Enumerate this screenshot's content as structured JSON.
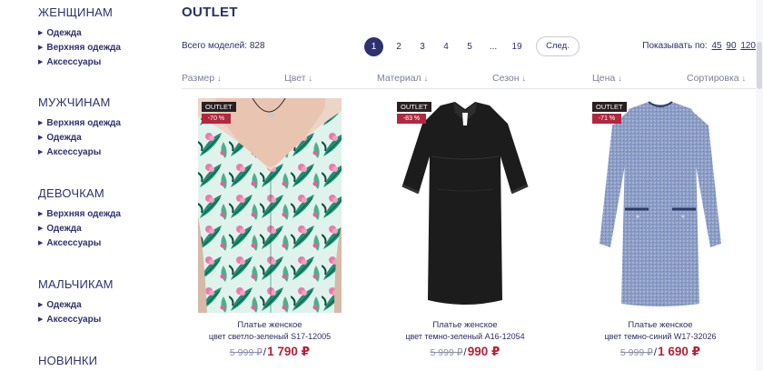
{
  "sidebar": {
    "women": {
      "title": "ЖЕНЩИНАМ",
      "items": [
        "Одежда",
        "Верхняя одежда",
        "Аксессуары"
      ]
    },
    "men": {
      "title": "МУЖЧИНАМ",
      "items": [
        "Верхняя одежда",
        "Одежда",
        "Аксессуары"
      ]
    },
    "girls": {
      "title": "ДЕВОЧКАМ",
      "items": [
        "Верхняя одежда",
        "Одежда",
        "Аксессуары"
      ]
    },
    "boys": {
      "title": "МАЛЬЧИКАМ",
      "items": [
        "Одежда",
        "Аксессуары"
      ]
    },
    "new": {
      "title": "НОВИНКИ"
    }
  },
  "header": {
    "title": "OUTLET",
    "total_models": "Всего моделей: 828"
  },
  "pagination": {
    "pages": [
      "1",
      "2",
      "3",
      "4",
      "5",
      "...",
      "19"
    ],
    "current": "1",
    "next_label": "След."
  },
  "per_page": {
    "label": "Показывать по:",
    "options": [
      "45",
      "90",
      "120"
    ]
  },
  "filters": [
    "Размер",
    "Цвет",
    "Материал",
    "Сезон",
    "Цена",
    "Сортировка"
  ],
  "filter_arrow": "↓",
  "products": [
    {
      "badge": "OUTLET",
      "discount": "-70 %",
      "name": "Платье женское",
      "color": "цвет светло-зеленый S17-12005",
      "old_price": "5 999 ₽",
      "price": "1 790 ₽"
    },
    {
      "badge": "OUTLET",
      "discount": "-83 %",
      "name": "Платье женское",
      "color": "цвет темно-зеленый A16-12054",
      "old_price": "5 999 ₽",
      "price": "990 ₽"
    },
    {
      "badge": "OUTLET",
      "discount": "-71 %",
      "name": "Платье женское",
      "color": "цвет темно-синий W17-32026",
      "old_price": "5 999 ₽",
      "price": "1 690 ₽"
    }
  ],
  "price_separator": "/",
  "colors": {
    "brand": "#2e3070",
    "sale": "#b3223a",
    "badge_dark": "#2a2022",
    "badge_red": "#b0283f"
  }
}
